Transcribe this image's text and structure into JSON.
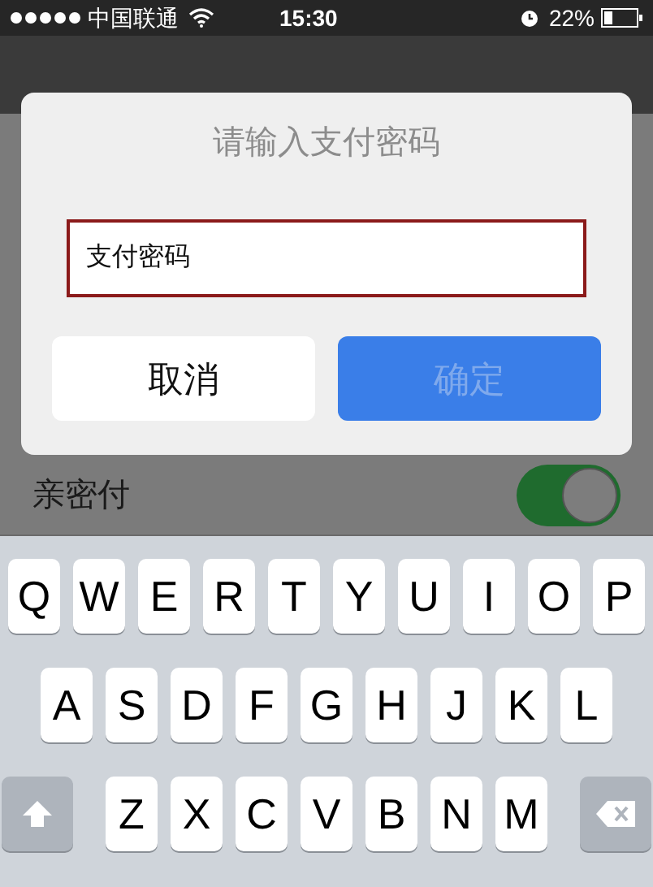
{
  "status_bar": {
    "carrier": "中国联通",
    "time": "15:30",
    "battery": "22%"
  },
  "dialog": {
    "title": "请输入支付密码",
    "field": {
      "placeholder": "支付密码"
    },
    "buttons": [
      {
        "label": "取消",
        "kind": "cancel",
        "disabled": false
      },
      {
        "label": "确定",
        "kind": "confirm",
        "disabled": true
      }
    ]
  },
  "setting": {
    "label": "亲密付",
    "on": true
  },
  "keyboard": {
    "rows": [
      [
        {
          "kind": "letter",
          "label": "Q"
        },
        {
          "kind": "letter",
          "label": "W"
        },
        {
          "kind": "letter",
          "label": "E"
        },
        {
          "kind": "letter",
          "label": "R"
        },
        {
          "kind": "letter",
          "label": "T"
        },
        {
          "kind": "letter",
          "label": "Y"
        },
        {
          "kind": "letter",
          "label": "U"
        },
        {
          "kind": "letter",
          "label": "I"
        },
        {
          "kind": "letter",
          "label": "O"
        },
        {
          "kind": "letter",
          "label": "P"
        }
      ],
      [
        {
          "kind": "letter",
          "label": "A"
        },
        {
          "kind": "letter",
          "label": "S"
        },
        {
          "kind": "letter",
          "label": "D"
        },
        {
          "kind": "letter",
          "label": "F"
        },
        {
          "kind": "letter",
          "label": "G"
        },
        {
          "kind": "letter",
          "label": "H"
        },
        {
          "kind": "letter",
          "label": "J"
        },
        {
          "kind": "letter",
          "label": "K"
        },
        {
          "kind": "letter",
          "label": "L"
        }
      ],
      [
        {
          "kind": "shift"
        },
        {
          "kind": "letter",
          "label": "Z"
        },
        {
          "kind": "letter",
          "label": "X"
        },
        {
          "kind": "letter",
          "label": "C"
        },
        {
          "kind": "letter",
          "label": "V"
        },
        {
          "kind": "letter",
          "label": "B"
        },
        {
          "kind": "letter",
          "label": "N"
        },
        {
          "kind": "letter",
          "label": "M"
        },
        {
          "kind": "delete"
        }
      ]
    ]
  }
}
